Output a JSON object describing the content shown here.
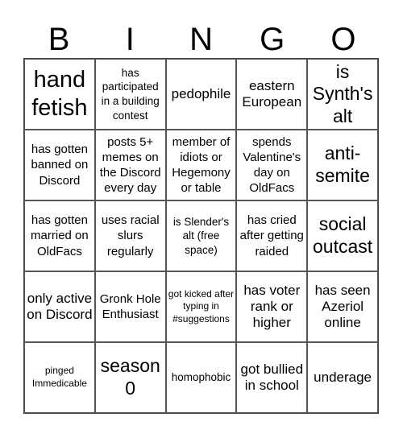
{
  "header": [
    "B",
    "I",
    "N",
    "G",
    "O"
  ],
  "cells": [
    {
      "text": "hand fetish",
      "size": "xl"
    },
    {
      "text": "has participated in a building contest",
      "size": "s"
    },
    {
      "text": "pedophile",
      "size": "m"
    },
    {
      "text": "eastern European",
      "size": "m"
    },
    {
      "text": "is Synth's alt",
      "size": "l"
    },
    {
      "text": "has gotten banned on Discord",
      "size": "n"
    },
    {
      "text": "posts 5+ memes on the Discord every day",
      "size": "n"
    },
    {
      "text": "member of idiots or Hegemony or table",
      "size": "n"
    },
    {
      "text": "spends Valentine's day on OldFacs",
      "size": "n"
    },
    {
      "text": "anti-semite",
      "size": "l"
    },
    {
      "text": "has gotten married on OldFacs",
      "size": "n"
    },
    {
      "text": "uses racial slurs regularly",
      "size": "n"
    },
    {
      "text": "is Slender's alt (free space)",
      "size": "s"
    },
    {
      "text": "has cried after getting raided",
      "size": "n"
    },
    {
      "text": "social outcast",
      "size": "l"
    },
    {
      "text": "only active on Discord",
      "size": "m"
    },
    {
      "text": "Gronk Hole Enthusiast",
      "size": "n"
    },
    {
      "text": "got kicked after typing in #suggestions",
      "size": "xs"
    },
    {
      "text": "has voter rank or higher",
      "size": "m"
    },
    {
      "text": "has seen Azeriol online",
      "size": "m"
    },
    {
      "text": "pinged Immedicable",
      "size": "xs"
    },
    {
      "text": "season 0",
      "size": "l"
    },
    {
      "text": "homophobic",
      "size": "s"
    },
    {
      "text": "got bullied in school",
      "size": "m"
    },
    {
      "text": "underage",
      "size": "m"
    }
  ]
}
